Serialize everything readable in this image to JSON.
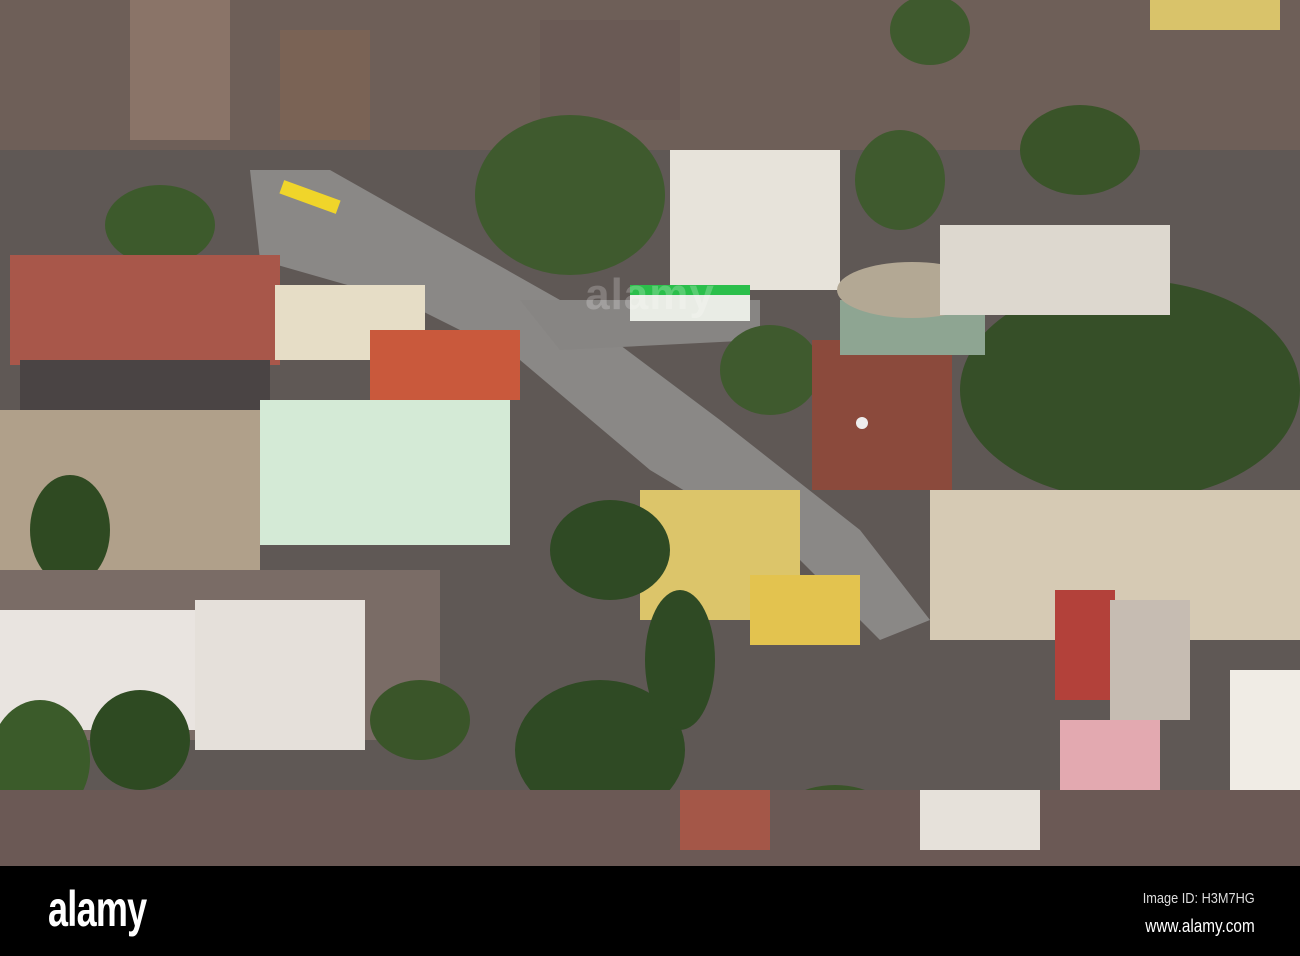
{
  "photo": {
    "description_label": "Aerial view of city district with water tower"
  },
  "watermark": {
    "center_text": "alamy"
  },
  "footer": {
    "logo": "alamy",
    "image_id": "Image ID: H3M7HG",
    "website": "www.alamy.com"
  }
}
